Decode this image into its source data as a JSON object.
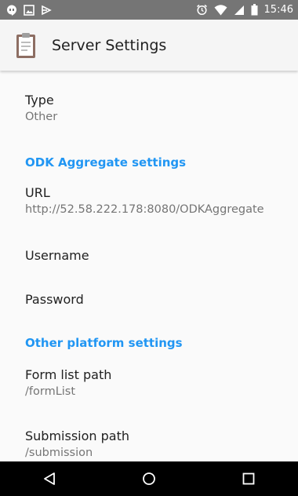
{
  "status_bar": {
    "time": "15:46",
    "left_icons": [
      "hangouts-icon",
      "image-icon",
      "cast-icon"
    ],
    "right_icons": [
      "alarm-icon",
      "wifi-icon",
      "signal-icon",
      "battery-icon"
    ]
  },
  "app_bar": {
    "title": "Server Settings",
    "icon": "clipboard-icon"
  },
  "settings": {
    "type": {
      "title": "Type",
      "summary": "Other"
    },
    "aggregate_header": "ODK Aggregate settings",
    "url": {
      "title": "URL",
      "summary": "http://52.58.222.178:8080/ODKAggregate"
    },
    "username": {
      "title": "Username"
    },
    "password": {
      "title": "Password"
    },
    "other_header": "Other platform settings",
    "form_list": {
      "title": "Form list path",
      "summary": "/formList"
    },
    "submission": {
      "title": "Submission path",
      "summary": "/submission"
    }
  },
  "nav_bar": {
    "buttons": [
      "back-icon",
      "home-icon",
      "recents-icon"
    ]
  },
  "colors": {
    "accent": "#2196f3",
    "status_bar": "#757575",
    "app_bar": "#f5f5f5",
    "background": "#fafafa",
    "nav_bar": "#000000"
  }
}
